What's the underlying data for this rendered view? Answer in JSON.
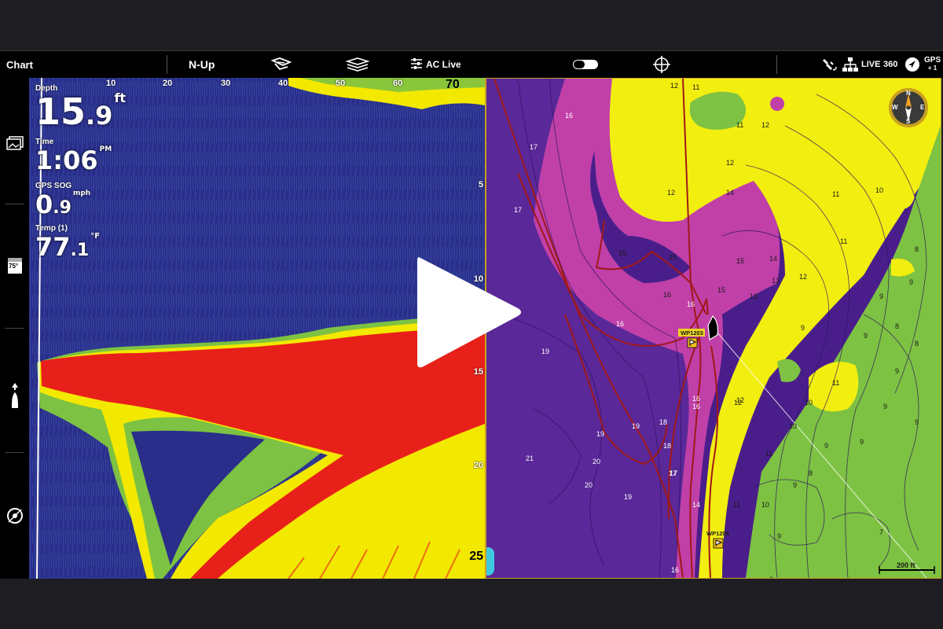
{
  "toolbar": {
    "chart_label": "Chart",
    "orientation_label": "N-Up",
    "ac_live_label": "AC Live",
    "live_label": "LIVE",
    "three60_label": "360",
    "gps_label": "GPS",
    "gps_sub": "+ 1"
  },
  "sidebar": {
    "temp_icon_label": "75°"
  },
  "sonar": {
    "depth": {
      "label": "Depth",
      "value": "15",
      "decimal": ".9",
      "unit": "ft"
    },
    "time": {
      "label": "Time",
      "value": "1:06",
      "suffix": "PM"
    },
    "sog": {
      "label": "GPS SOG",
      "value": "0",
      "decimal": ".9",
      "unit": "mph"
    },
    "temp": {
      "label": "Temp (1)",
      "value": "77",
      "decimal": ".1",
      "unit": "°F"
    },
    "range_top": "70",
    "range_bottom": "25",
    "x_scale": [
      "10",
      "20",
      "30",
      "40",
      "50",
      "60"
    ],
    "y_scale": [
      "5",
      "10",
      "15",
      "20"
    ]
  },
  "chart": {
    "waypoints": [
      "WP1203",
      "WP1205"
    ],
    "scale_label": "200 ft",
    "compass": {
      "n": "N",
      "e": "E",
      "s": "S",
      "w": "W"
    },
    "depth_labels": [
      "12",
      "11",
      "12",
      "11",
      "12",
      "12",
      "11",
      "14",
      "15",
      "15",
      "16",
      "15",
      "15",
      "14",
      "13",
      "12",
      "11",
      "10",
      "16",
      "16",
      "17",
      "17",
      "16",
      "18",
      "19",
      "19",
      "20",
      "21",
      "20",
      "19",
      "18",
      "17",
      "16",
      "14",
      "13",
      "12",
      "11",
      "10",
      "9",
      "8",
      "9",
      "9",
      "9",
      "8",
      "8",
      "9",
      "9",
      "9",
      "9",
      "9",
      "9",
      "11",
      "9",
      "10",
      "8",
      "7",
      "11",
      "10",
      "9",
      "12",
      "14",
      "16",
      "17",
      "19",
      "16"
    ]
  },
  "colors": {
    "sonar_bg": "#2a2e8a",
    "sonar_red": "#e8201a",
    "sonar_yellow": "#f2e800",
    "chart_deep": "#4a1e8a",
    "chart_magenta": "#c040a8",
    "chart_yellow": "#f2ee10",
    "chart_green": "#7dc242",
    "track": "#a01818",
    "accent_gold": "#c8a020"
  },
  "icons": [
    "chart-settings-icon",
    "layers-icon",
    "ac-live-icon",
    "sonar-toggle-icon",
    "crosshair-icon",
    "satellite-icon",
    "network-icon",
    "navigate-icon",
    "gps-icon",
    "photo-icon",
    "temperature-icon",
    "boat-icon",
    "compass-icon",
    "play-icon"
  ]
}
